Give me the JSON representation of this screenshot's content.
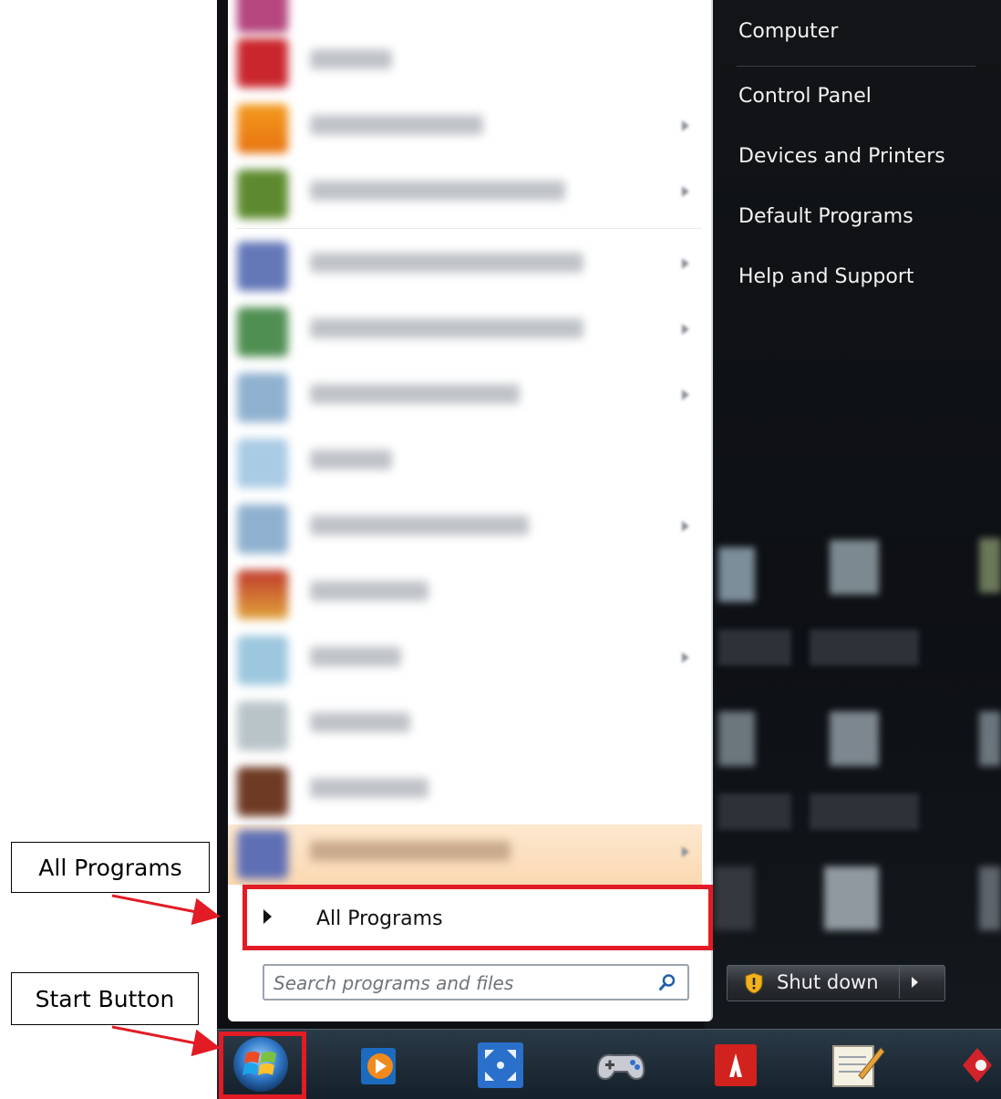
{
  "right_menu": {
    "items": [
      "Computer",
      "Control Panel",
      "Devices and Printers",
      "Default Programs",
      "Help and Support"
    ]
  },
  "left_menu": {
    "all_programs_label": "All Programs"
  },
  "search": {
    "placeholder": "Search programs and files"
  },
  "shutdown": {
    "label": "Shut down"
  },
  "annotations": {
    "all_programs_callout": "All Programs",
    "start_button_callout": "Start Button"
  },
  "colors": {
    "highlight": "#e21b24",
    "menu_background": "#ffffff",
    "right_pane_background": "#121417"
  }
}
